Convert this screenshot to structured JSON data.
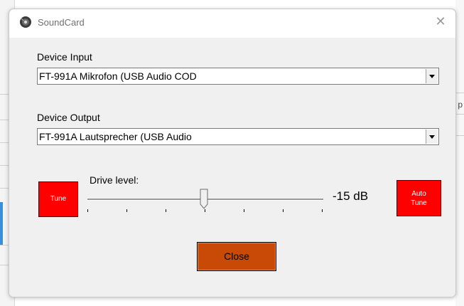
{
  "window": {
    "title": "SoundCard",
    "close_glyph": "✕",
    "icon": "speaker-icon"
  },
  "device_input": {
    "label": "Device Input",
    "value": "FT-991A Mikrofon (USB Audio COD"
  },
  "device_output": {
    "label": "Device Output",
    "value": "FT-991A Lautsprecher (USB Audio"
  },
  "drive": {
    "label": "Drive level:",
    "readout": "-15 dB",
    "tick_count": 7
  },
  "buttons": {
    "tune": "Tune",
    "auto_tune_line1": "Auto",
    "auto_tune_line2": "Tune",
    "close": "Close"
  },
  "background": {
    "right_char": "p"
  },
  "colors": {
    "tune_red": "#ff0000",
    "close_orange": "#c84a06",
    "dialog_bg": "#f0f0f0"
  }
}
